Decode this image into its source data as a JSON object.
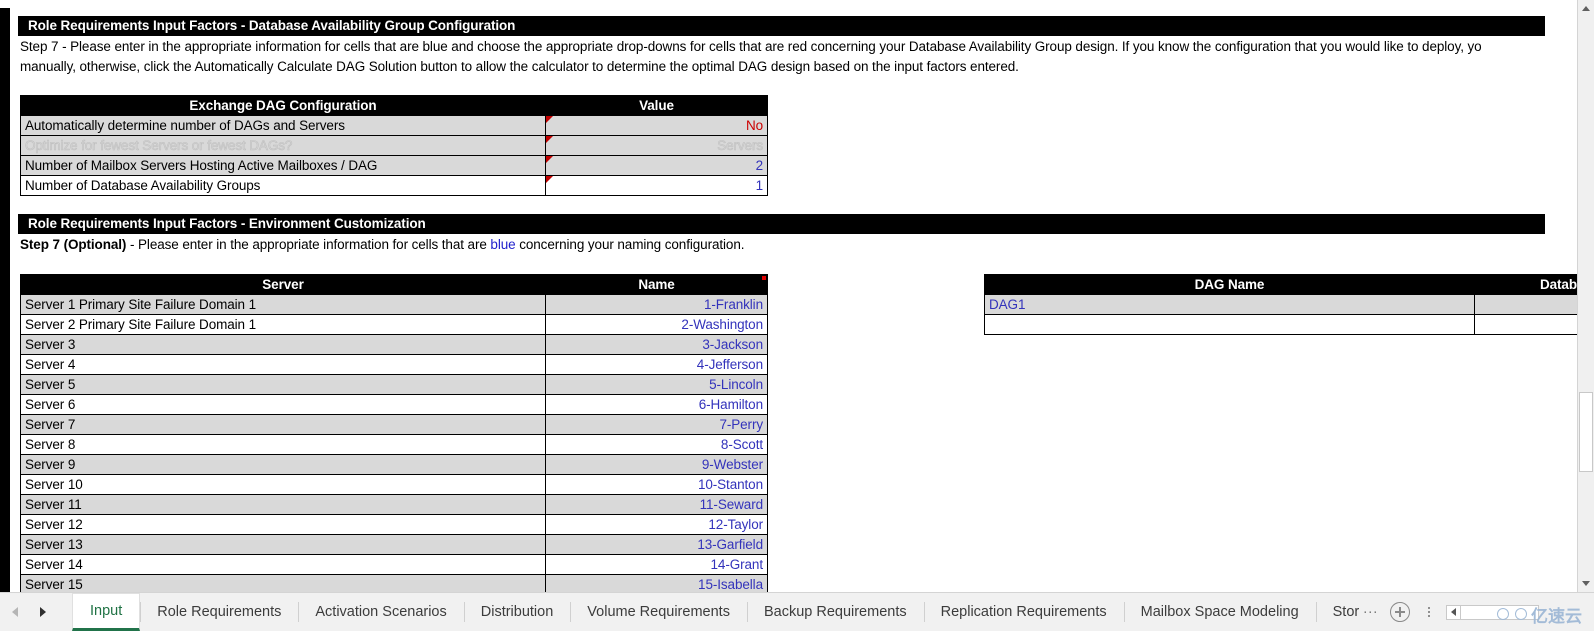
{
  "section1": {
    "title": "Role Requirements Input Factors - Database Availability Group Configuration",
    "desc_line1": "Step 7 - Please enter in the appropriate information for cells that are blue and choose the appropriate drop-downs for cells that are red concerning your Database Availability Group design.  If you know the configuration that you would like to deploy, yo",
    "desc_line2": "manually, otherwise, click the Automatically Calculate DAG Solution button to allow the calculator to determine the optimal DAG design based on the input factors entered."
  },
  "dag_config_table": {
    "headers": [
      "Exchange DAG Configuration",
      "Value"
    ],
    "rows": [
      {
        "label": "Automatically determine number of DAGs and Servers",
        "value": "No",
        "value_color": "red",
        "shade": "gray",
        "disabled": false
      },
      {
        "label": "Optimize for fewest Servers or fewest DAGs?",
        "value": "Servers",
        "value_color": "disabled",
        "shade": "gray",
        "disabled": true
      },
      {
        "label": "Number of Mailbox Servers Hosting Active Mailboxes / DAG",
        "value": "2",
        "value_color": "blue",
        "shade": "gray",
        "disabled": false
      },
      {
        "label": "Number of Database Availability Groups",
        "value": "1",
        "value_color": "blue",
        "shade": "white",
        "disabled": false
      }
    ]
  },
  "section2": {
    "title": "Role Requirements Input Factors - Environment Customization",
    "desc_prefix": "Step 7 (Optional)",
    "desc_mid": " - Please enter in the appropriate information for cells that are ",
    "desc_blue": "blue",
    "desc_suffix": " concerning your naming configuration."
  },
  "server_table": {
    "headers": [
      "Server",
      "Name"
    ],
    "rows": [
      {
        "label": "Server 1 Primary Site Failure Domain 1",
        "name": "1-Franklin",
        "shade": "gray"
      },
      {
        "label": "Server 2 Primary Site Failure Domain 1",
        "name": "2-Washington",
        "shade": "white"
      },
      {
        "label": "Server 3",
        "name": "3-Jackson",
        "shade": "gray"
      },
      {
        "label": "Server 4",
        "name": "4-Jefferson",
        "shade": "white"
      },
      {
        "label": "Server 5",
        "name": "5-Lincoln",
        "shade": "gray"
      },
      {
        "label": "Server 6",
        "name": "6-Hamilton",
        "shade": "white"
      },
      {
        "label": "Server 7",
        "name": "7-Perry",
        "shade": "gray"
      },
      {
        "label": "Server 8",
        "name": "8-Scott",
        "shade": "white"
      },
      {
        "label": "Server 9",
        "name": "9-Webster",
        "shade": "gray"
      },
      {
        "label": "Server 10",
        "name": "10-Stanton",
        "shade": "white"
      },
      {
        "label": "Server 11",
        "name": "11-Seward",
        "shade": "gray"
      },
      {
        "label": "Server 12",
        "name": "12-Taylor",
        "shade": "white"
      },
      {
        "label": "Server 13",
        "name": "13-Garfield",
        "shade": "gray"
      },
      {
        "label": "Server 14",
        "name": "14-Grant",
        "shade": "white"
      },
      {
        "label": "Server 15",
        "name": "15-Isabella",
        "shade": "gray"
      }
    ]
  },
  "dag_name_table": {
    "headers": [
      "DAG Name",
      "Datab"
    ],
    "rows": [
      {
        "dag_name": "DAG1",
        "database": "",
        "shade": "gray"
      },
      {
        "dag_name": "",
        "database": "",
        "shade": "white"
      }
    ]
  },
  "tabbar": {
    "nav_left": "previous-sheet",
    "nav_right": "next-sheet",
    "tabs": [
      {
        "label": "Input",
        "active": true
      },
      {
        "label": "Role Requirements",
        "active": false
      },
      {
        "label": "Activation Scenarios",
        "active": false
      },
      {
        "label": "Distribution",
        "active": false
      },
      {
        "label": "Volume Requirements",
        "active": false
      },
      {
        "label": "Backup Requirements",
        "active": false
      },
      {
        "label": "Replication Requirements",
        "active": false
      },
      {
        "label": "Mailbox Space Modeling",
        "active": false
      },
      {
        "label": "Stor",
        "active": false
      }
    ],
    "overflow_ellipsis": "...",
    "add_sheet_label": "+"
  },
  "watermark": {
    "text": "亿速云"
  },
  "colors": {
    "header_black": "#000000",
    "row_gray": "#d9d9d9",
    "input_blue": "#3333bb",
    "dropdown_red": "#cc0000",
    "tab_active_green": "#21734a"
  }
}
